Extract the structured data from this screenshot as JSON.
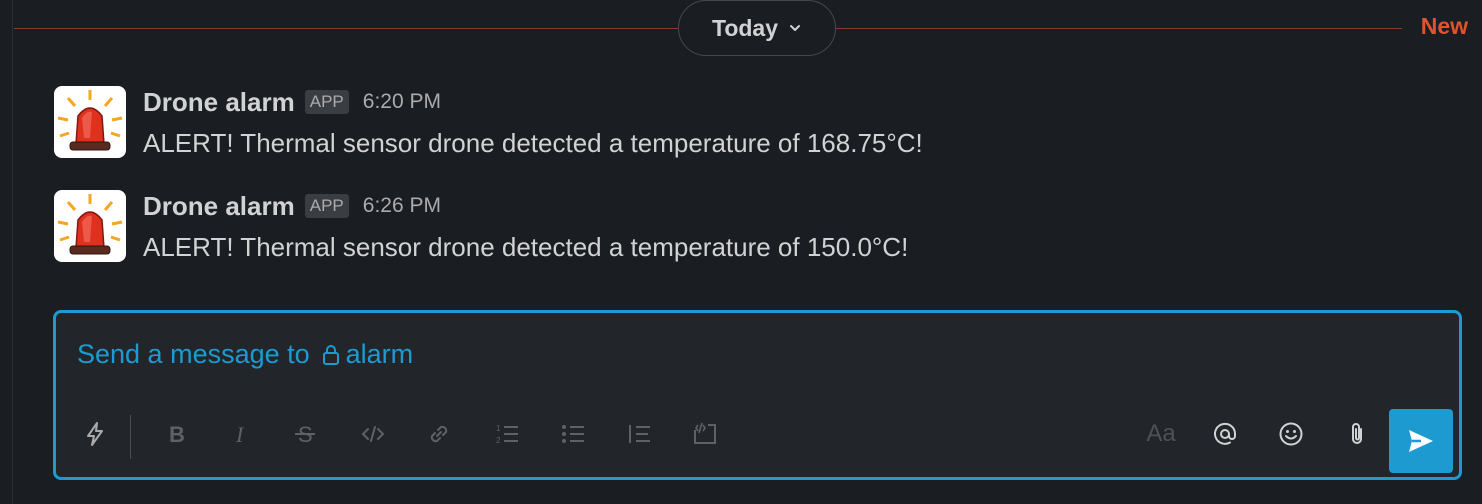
{
  "divider": {
    "day_label": "Today",
    "new_label": "New"
  },
  "messages": [
    {
      "sender": "Drone alarm",
      "badge": "APP",
      "time": "6:20 PM",
      "text": "ALERT! Thermal sensor drone detected a temperature of 168.75°C!",
      "avatar_icon": "siren-icon"
    },
    {
      "sender": "Drone alarm",
      "badge": "APP",
      "time": "6:26 PM",
      "text": "ALERT! Thermal sensor drone detected a temperature of 150.0°C!",
      "avatar_icon": "siren-icon"
    }
  ],
  "composer": {
    "placeholder_prefix": "Send a message to",
    "channel": "alarm",
    "text_style_label": "Aa"
  },
  "colors": {
    "background": "#1a1d21",
    "accent": "#1d9bd1",
    "new_marker": "#e0532f",
    "composer_bg": "#222529"
  }
}
